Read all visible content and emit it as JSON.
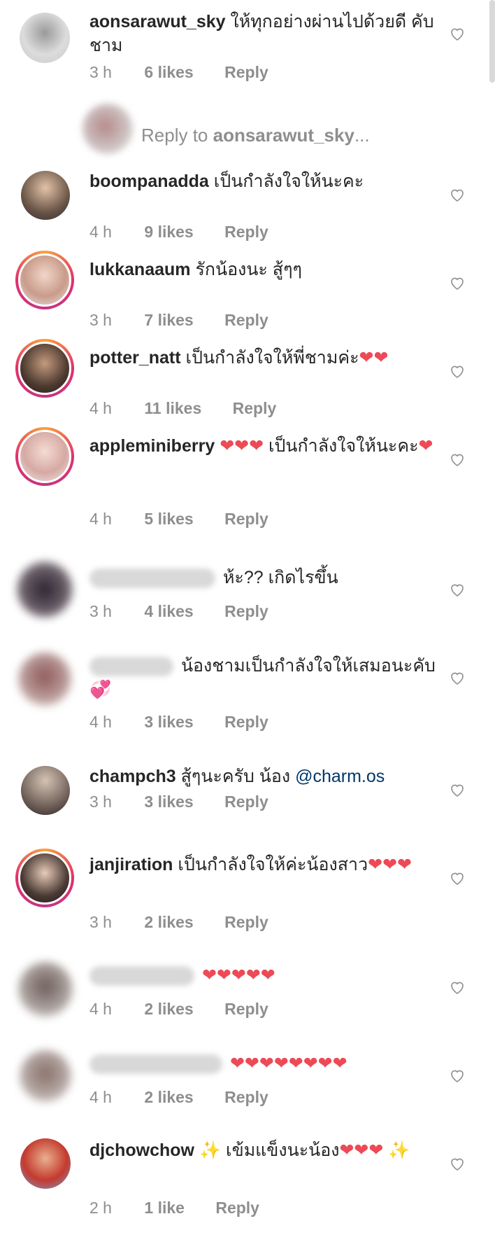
{
  "icon_color": "#8e8e8e",
  "reply_prompt": {
    "prefix": "Reply to ",
    "username": "aonsarawut_sky",
    "suffix": "..."
  },
  "comments": [
    {
      "user": "aonsarawut_sky",
      "text": "ให้ทุกอย่างผ่านไปด้วยดี คับชาม",
      "time": "3 h",
      "likes": "6 likes",
      "reply": "Reply"
    },
    {
      "user": "boompanadda",
      "text": "เป็นกำลังใจให้นะคะ",
      "time": "4 h",
      "likes": "9 likes",
      "reply": "Reply"
    },
    {
      "user": "lukkanaaum",
      "text": "รักน้องนะ สู้ๆๆ",
      "time": "3 h",
      "likes": "7 likes",
      "reply": "Reply"
    },
    {
      "user": "potter_natt",
      "text": "เป็นกำลังใจให้พี่ชามค่ะ❤❤",
      "time": "4 h",
      "likes": "11 likes",
      "reply": "Reply"
    },
    {
      "user": "appleminiberry",
      "text": "❤❤❤ เป็นกำลังใจให้นะคะ❤",
      "time": "4 h",
      "likes": "5 likes",
      "reply": "Reply"
    },
    {
      "user": "",
      "text": "ห้ะ?? เกิดไรขึ้น",
      "time": "3 h",
      "likes": "4 likes",
      "reply": "Reply"
    },
    {
      "user": "",
      "text": "น้องชามเป็นกำลังใจให้เสมอนะคับ💞",
      "time": "4 h",
      "likes": "3 likes",
      "reply": "Reply"
    },
    {
      "user": "champch3",
      "text": "สู้ๆนะครับ น้อง ",
      "mention": "@charm.os",
      "time": "3 h",
      "likes": "3 likes",
      "reply": "Reply"
    },
    {
      "user": "janjiration",
      "text": "เป็นกำลังใจให้ค่ะน้องสาว❤❤❤",
      "time": "3 h",
      "likes": "2 likes",
      "reply": "Reply"
    },
    {
      "user": "",
      "text": "❤❤❤❤❤",
      "time": "4 h",
      "likes": "2 likes",
      "reply": "Reply"
    },
    {
      "user": "",
      "text": "❤❤❤❤❤❤❤❤",
      "time": "4 h",
      "likes": "2 likes",
      "reply": "Reply"
    },
    {
      "user": "djchowchow",
      "text": "✨ เข้มแข็งนะน้อง❤❤❤ ✨",
      "time": "2 h",
      "likes": "1 like",
      "reply": "Reply"
    }
  ]
}
